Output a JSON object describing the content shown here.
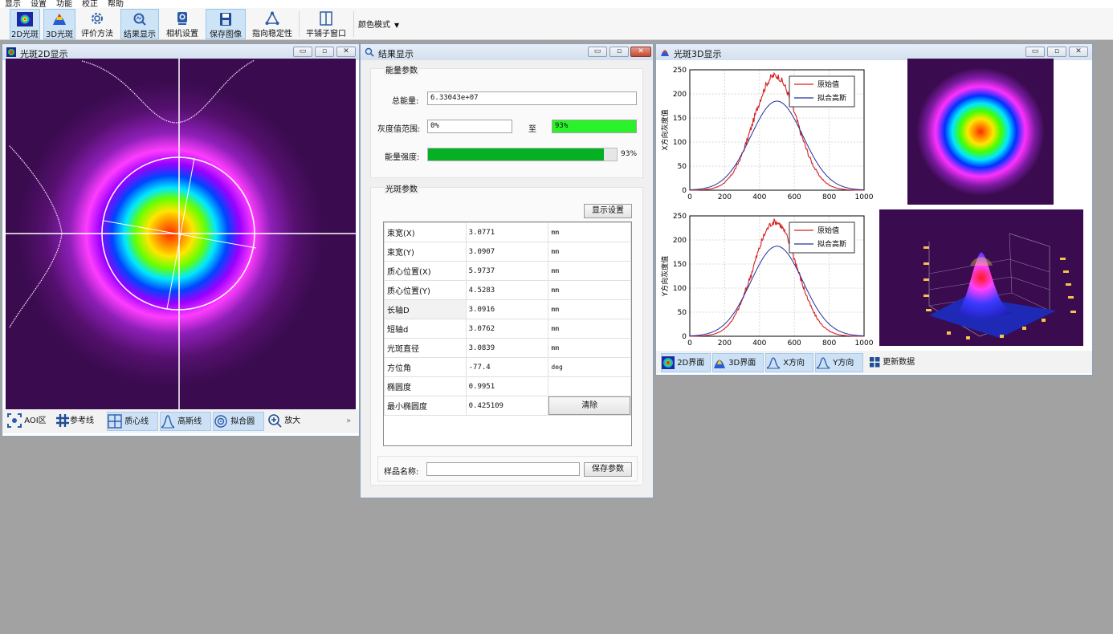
{
  "menu": [
    "显示",
    "设置",
    "功能",
    "校正",
    "帮助"
  ],
  "toolbar": {
    "b2d": "2D光斑",
    "b3d": "3D光斑",
    "eval": "评价方法",
    "result": "结果显示",
    "camera": "相机设置",
    "save": "保存图像",
    "pointing": "指向稳定性",
    "tile": "平铺子窗口",
    "color": "颜色模式"
  },
  "win2d": {
    "title": "光斑2D显示",
    "bottom": {
      "aoi": "AOI区",
      "ref": "参考线",
      "centroid": "质心线",
      "gauss": "高斯线",
      "fit": "拟合圆",
      "zoom": "放大",
      "more": "»"
    }
  },
  "result": {
    "title": "结果显示",
    "energy": {
      "group": "能量参数",
      "total_label": "总能量:",
      "total_value": "6.33043e+07",
      "gray_label": "灰度值范围:",
      "gray_from": "0%",
      "gray_to_label": "至",
      "gray_to": "93%",
      "intensity_label": "能量强度:",
      "intensity_text": "93%",
      "intensity_fraction": 0.93
    },
    "spot": {
      "group": "光斑参数",
      "settings_btn": "显示设置",
      "rows": [
        {
          "name": "束宽(X)",
          "value": "3.0771",
          "unit": "mm"
        },
        {
          "name": "束宽(Y)",
          "value": "3.0907",
          "unit": "mm"
        },
        {
          "name": "质心位置(X)",
          "value": "5.9737",
          "unit": "mm"
        },
        {
          "name": "质心位置(Y)",
          "value": "4.5283",
          "unit": "mm"
        },
        {
          "name": "长轴D",
          "value": "3.0916",
          "unit": "mm"
        },
        {
          "name": "短轴d",
          "value": "3.0762",
          "unit": "mm"
        },
        {
          "name": "光斑直径",
          "value": "3.0839",
          "unit": "mm"
        },
        {
          "name": "方位角",
          "value": "-77.4",
          "unit": "deg"
        },
        {
          "name": "椭圆度",
          "value": "0.9951",
          "unit": ""
        },
        {
          "name": "最小椭圆度",
          "value": "0.425109",
          "unit": ""
        }
      ],
      "clear_btn": "清除"
    },
    "sample_label": "样品名称:",
    "sample_value": "",
    "save_btn": "保存参数"
  },
  "win3d": {
    "title": "光斑3D显示",
    "bottom": {
      "tab2d": "2D界面",
      "tab3d": "3D界面",
      "x": "X方向",
      "y": "Y方向",
      "refresh": "更新数据"
    }
  },
  "chart_data": [
    {
      "type": "line",
      "ylabel": "X方向灰度值",
      "xlim": [
        0,
        1000
      ],
      "ylim": [
        0,
        250
      ],
      "xticks": [
        "0",
        "200",
        "400",
        "600",
        "800",
        "1000"
      ],
      "yticks": [
        "0",
        "50",
        "100",
        "150",
        "200",
        "250"
      ],
      "series": [
        {
          "name": "原始值",
          "color": "#d62020",
          "peak": 238,
          "center": 490,
          "sigma": 125
        },
        {
          "name": "拟合高斯",
          "color": "#2030a0",
          "peak": 185,
          "center": 500,
          "sigma": 150
        }
      ],
      "legend": "top-right",
      "grid": true
    },
    {
      "type": "line",
      "ylabel": "Y方向灰度值",
      "xlim": [
        0,
        1000
      ],
      "ylim": [
        0,
        250
      ],
      "xticks": [
        "0",
        "200",
        "400",
        "600",
        "800",
        "1000"
      ],
      "yticks": [
        "0",
        "50",
        "100",
        "150",
        "200",
        "250"
      ],
      "series": [
        {
          "name": "原始值",
          "color": "#d62020",
          "peak": 238,
          "center": 490,
          "sigma": 125
        },
        {
          "name": "拟合高斯",
          "color": "#2030a0",
          "peak": 187,
          "center": 500,
          "sigma": 150
        }
      ],
      "legend": "top-right",
      "grid": true
    }
  ]
}
